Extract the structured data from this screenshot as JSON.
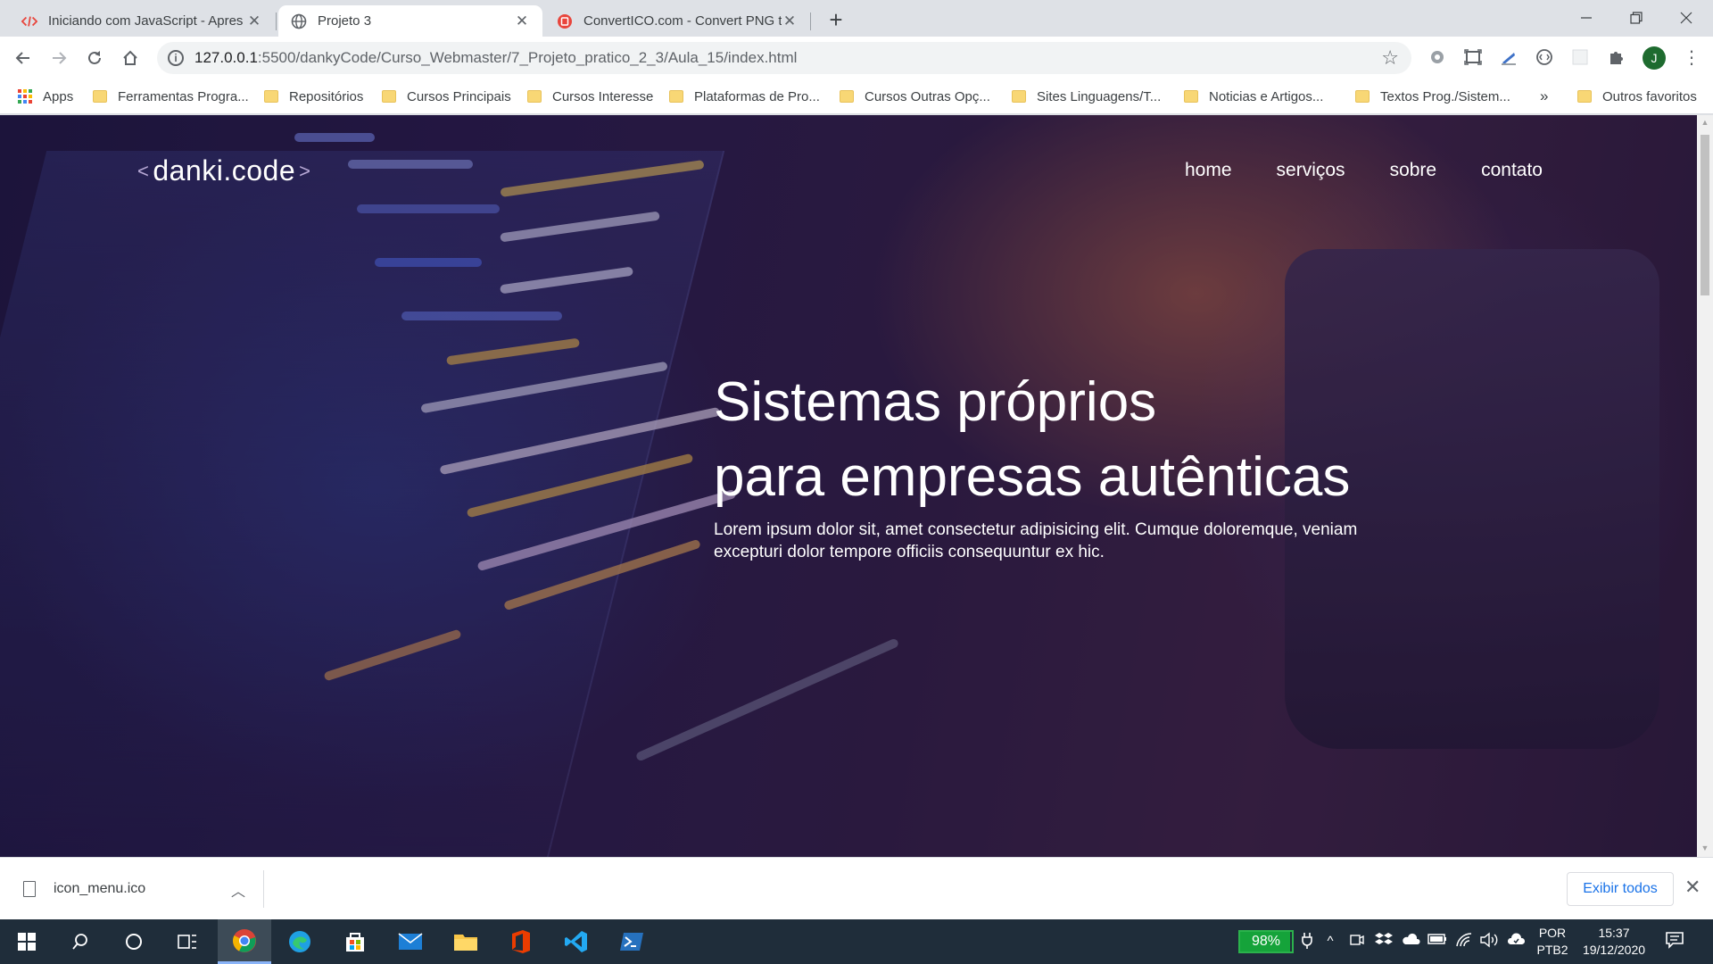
{
  "browser": {
    "tabs": [
      {
        "title": "Iniciando com JavaScript - Apres",
        "icon": "code-icon",
        "active": false
      },
      {
        "title": "Projeto 3",
        "icon": "globe-icon",
        "active": true
      },
      {
        "title": "ConvertICO.com - Convert PNG t",
        "icon": "converticio-icon",
        "active": false
      }
    ],
    "new_tab": "+",
    "url_host": "127.0.0.1",
    "url_rest": ":5500/dankyCode/Curso_Webmaster/7_Projeto_pratico_2_3/Aula_15/index.html",
    "profile_initial": "J"
  },
  "bookmarks": {
    "apps": "Apps",
    "items": [
      "Ferramentas Progra...",
      "Repositórios",
      "Cursos Principais",
      "Cursos Interesse",
      "Plataformas de Pro...",
      "Cursos Outras Opç...",
      "Sites Linguagens/T...",
      "Noticias e Artigos...",
      "Textos Prog./Sistem..."
    ],
    "overflow": "»",
    "other": "Outros favoritos"
  },
  "site": {
    "logo": "danki.code",
    "logo_left": "<",
    "logo_right": ">",
    "nav": [
      "home",
      "serviços",
      "sobre",
      "contato"
    ],
    "hero_line1": "Sistemas próprios",
    "hero_line2": "para empresas autênticas",
    "hero_text": "Lorem ipsum dolor sit, amet consectetur adipisicing elit. Cumque doloremque, veniam excepturi dolor tempore officiis consequuntur ex hic."
  },
  "downloads": {
    "file": "icon_menu.ico",
    "show_all": "Exibir todos"
  },
  "taskbar": {
    "battery": "98%",
    "lang_line1": "POR",
    "lang_line2": "PTB2",
    "time": "15:37",
    "date": "19/12/2020"
  },
  "colors": {
    "accent_blue": "#1a73e8",
    "taskbar_bg": "#1f2d3a",
    "battery_green": "#15a33a"
  }
}
